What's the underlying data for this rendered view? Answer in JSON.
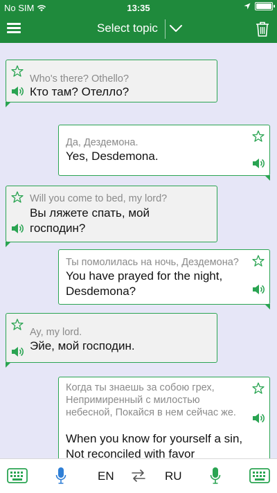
{
  "status_bar": {
    "carrier": "No SIM",
    "time": "13:35"
  },
  "nav": {
    "title": "Select topic"
  },
  "colors": {
    "primary_green": "#1f8a3c",
    "accent_green": "#2aa452",
    "chat_background": "#e6e6f7"
  },
  "icons": {
    "menu": "hamburger-menu-icon",
    "dropdown": "chevron-down-icon",
    "trash": "trash-icon",
    "favorite": "star-outline-icon",
    "speaker": "speaker-icon",
    "keyboard": "keyboard-icon",
    "microphone": "microphone-icon",
    "swap": "swap-arrows-icon"
  },
  "messages": [
    {
      "side": "left",
      "source": "Who's there? Othello?",
      "translation": "Кто там? Отелло?"
    },
    {
      "side": "right",
      "source": "Да, Дездемона.",
      "translation": "Yes, Desdemona."
    },
    {
      "side": "left",
      "source": "Will you come to bed, my lord?",
      "translation": "Вы ляжете спать, мой господин?"
    },
    {
      "side": "right",
      "source": "Ты помолилась на ночь, Дездемона?",
      "translation": "You have prayed for the night, Desdemona?"
    },
    {
      "side": "left",
      "source": "Ay, my lord.",
      "translation": "Эйе, мой господин."
    },
    {
      "side": "right",
      "source": "Когда ты знаешь за собою грех, Непримиренный с милостью небесной, Покайся в нем сейчас же.",
      "translation": "When you know for yourself a sin, Not reconciled with favor"
    }
  ],
  "bottom_bar": {
    "lang_left": "EN",
    "lang_right": "RU"
  }
}
